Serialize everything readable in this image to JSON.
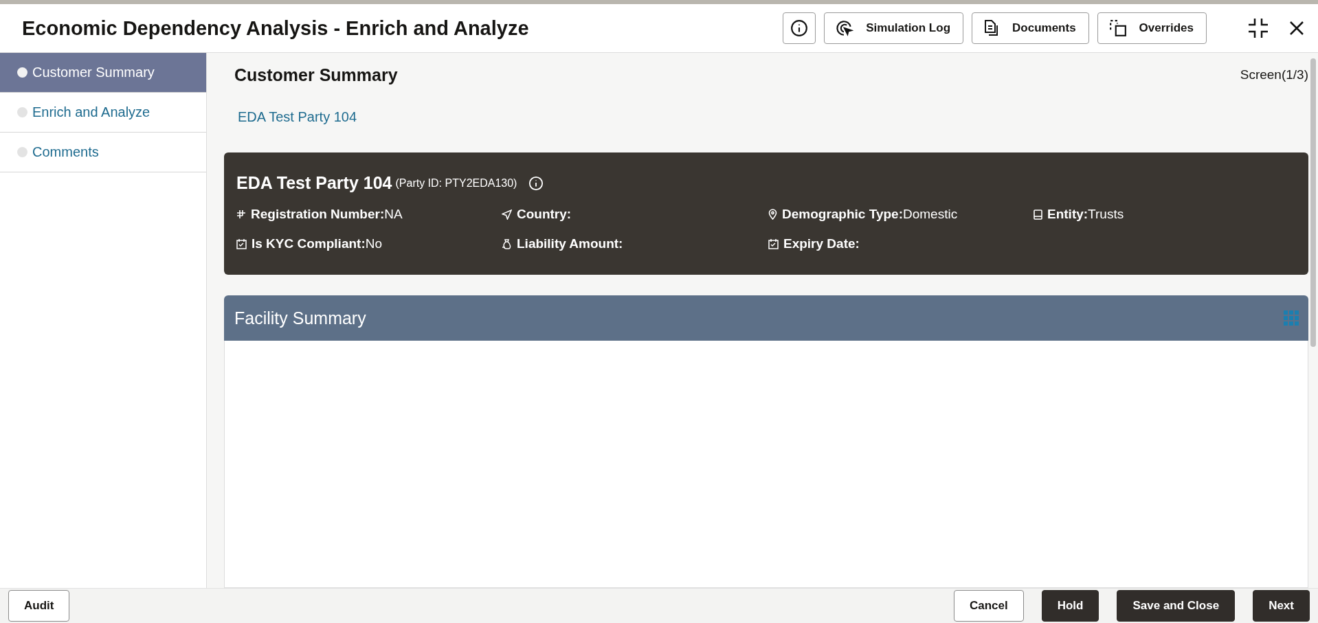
{
  "window": {
    "title": "Economic Dependency Analysis - Enrich and Analyze"
  },
  "toolbar": [
    {
      "kind": "info"
    },
    {
      "kind": "simulation",
      "label": "Simulation Log"
    },
    {
      "kind": "documents",
      "label": "Documents"
    },
    {
      "kind": "overrides",
      "label": "Overrides"
    }
  ],
  "steps": [
    {
      "label": "Customer Summary",
      "selected": true
    },
    {
      "label": "Enrich and Analyze",
      "selected": false
    },
    {
      "label": "Comments",
      "selected": false
    }
  ],
  "page": {
    "title": "Customer Summary",
    "screen": "Screen(1/3)",
    "link": "EDA Test Party 104"
  },
  "party": {
    "name": "EDA Test Party 104",
    "id": "(Party ID: PTY2EDA130)",
    "fields": [
      {
        "label": "Registration Number:",
        "value": "NA"
      },
      {
        "label": "Country:"
      },
      {
        "label": "Demographic Type:",
        "value": "Domestic"
      },
      {
        "label": "Entity:",
        "value": "Trusts"
      },
      {
        "label": "Is KYC Compliant:",
        "value": "No"
      },
      {
        "label": "Liability Amount:"
      },
      {
        "label": "Expiry Date:"
      }
    ]
  },
  "facility": {
    "title": "Facility Summary"
  },
  "footer": {
    "left": [
      {
        "label": "Audit",
        "kind": "outline"
      }
    ],
    "right": [
      {
        "label": "Cancel",
        "kind": "outline"
      },
      {
        "label": "Hold",
        "kind": "dark"
      },
      {
        "label": "Save and Close",
        "kind": "dark"
      },
      {
        "label": "Next",
        "kind": "dark"
      }
    ]
  }
}
